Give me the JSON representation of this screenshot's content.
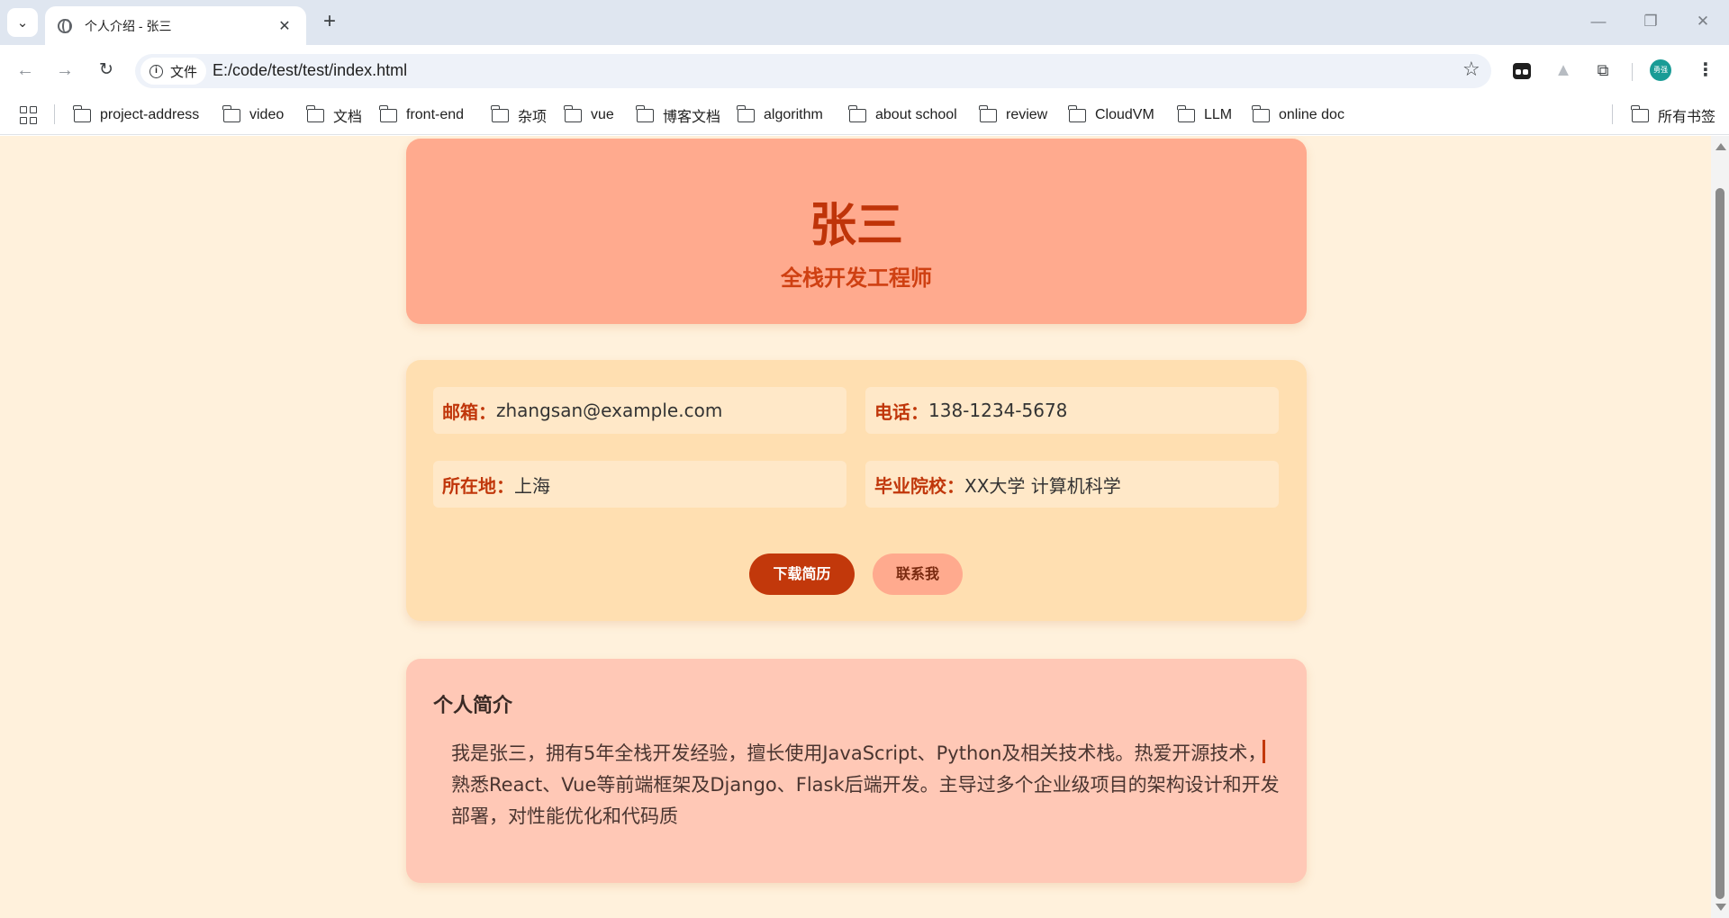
{
  "browser": {
    "tab": {
      "title": "个人介绍 - 张三"
    },
    "address": {
      "site_chip": "文件",
      "url": "E:/code/test/test/index.html"
    },
    "profile_avatar": "勇强",
    "bookmarks": [
      {
        "label": "project-address"
      },
      {
        "label": "video"
      },
      {
        "label": "文档"
      },
      {
        "label": "front-end"
      },
      {
        "label": "杂项"
      },
      {
        "label": "vue"
      },
      {
        "label": "博客文档"
      },
      {
        "label": "algorithm"
      },
      {
        "label": "about school"
      },
      {
        "label": "review"
      },
      {
        "label": "CloudVM"
      },
      {
        "label": "LLM"
      },
      {
        "label": "online doc"
      }
    ],
    "all_bookmarks": "所有书签",
    "icons": [
      "tab-search-icon",
      "globe-icon",
      "close-icon",
      "plus-icon",
      "minimize-icon",
      "maximize-icon",
      "window-close-icon",
      "back-arrow-icon",
      "forward-arrow-icon",
      "reload-icon",
      "info-icon",
      "star-icon",
      "extension-icon",
      "puzzle-icon",
      "menu-dots-icon",
      "apps-grid-icon",
      "folder-icon"
    ]
  },
  "page": {
    "header": {
      "name": "张三",
      "title": "全栈开发工程师"
    },
    "info": {
      "email_label": "邮箱：",
      "email": "zhangsan@example.com",
      "phone_label": "电话：",
      "phone": "138-1234-5678",
      "location_label": "所在地：",
      "location": "上海",
      "school_label": "毕业院校：",
      "school": "XX大学 计算机科学"
    },
    "buttons": {
      "download": "下载简历",
      "contact": "联系我"
    },
    "about": {
      "heading": "个人简介",
      "text": "我是张三，拥有5年全栈开发经验，擅长使用JavaScript、Python及相关技术栈。热爱开源技术，熟悉React、Vue等前端框架及Django、Flask后端开发。主导过多个企业级项目的架构设计和开发部署，对性能优化和代码质"
    }
  },
  "colors": {
    "page_bg": "#fff1dc",
    "header_card": "#ffaa8e",
    "info_card": "#ffdfb1",
    "about_card": "#ffc8b6",
    "accent": "#c2380b"
  }
}
